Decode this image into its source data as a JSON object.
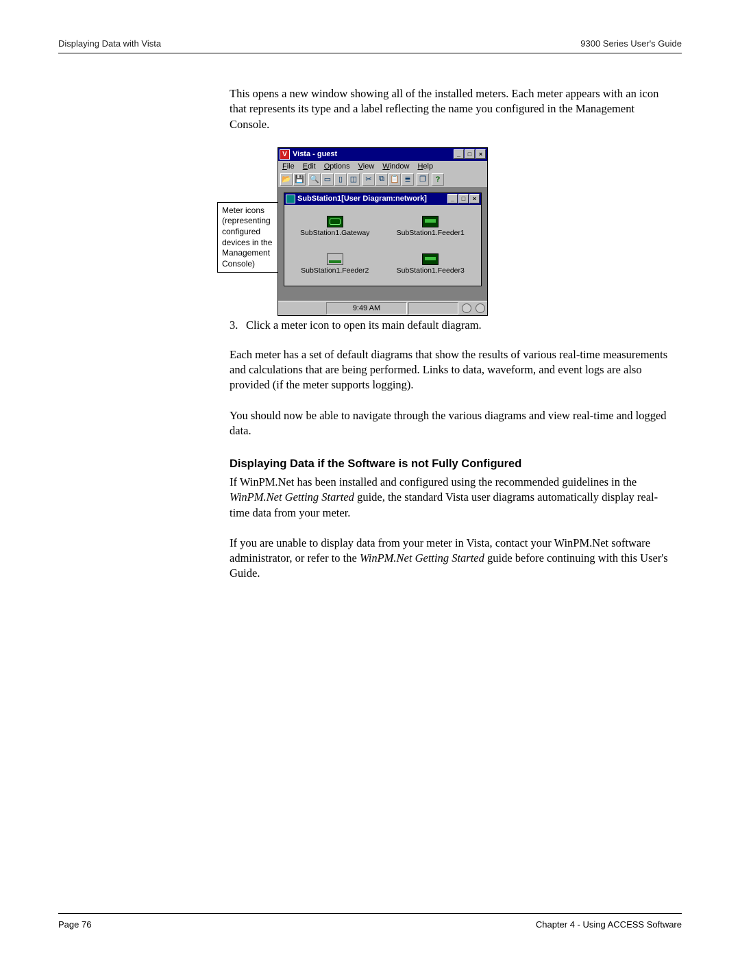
{
  "header": {
    "left": "Displaying Data with Vista",
    "right": "9300 Series User's Guide"
  },
  "intro_para": "This opens a new window showing all of the installed meters. Each meter appears with an icon that represents its type and a label reflecting the name you configured in the Management Console.",
  "callout": "Meter icons (representing configured devices in the Management Console)",
  "vista": {
    "title": "Vista - guest",
    "menus": {
      "file": "File",
      "edit": "Edit",
      "options": "Options",
      "view": "View",
      "window": "Window",
      "help": "Help"
    },
    "child_title": "SubStation1[User Diagram:network]",
    "meters": {
      "m1": "SubStation1.Gateway",
      "m2": "SubStation1.Feeder1",
      "m3": "SubStation1.Feeder2",
      "m4": "SubStation1.Feeder3"
    },
    "status_time": "9:49 AM"
  },
  "step3": {
    "num": "3.",
    "text": "Click a meter icon to open its main default diagram."
  },
  "para_diagrams": "Each meter has a set of default diagrams that show the results of various real-time measurements and calculations that are being performed. Links to data, waveform, and event logs are also provided (if the meter supports logging).",
  "para_navigate": "You should now be able to navigate through the various diagrams and view real-time and logged data.",
  "section_title": "Displaying Data if the Software is not Fully Configured",
  "sec_p1_a": "If WinPM.Net has been installed and configured using the recommended guidelines in the ",
  "sec_p1_i": "WinPM.Net Getting Started",
  "sec_p1_b": " guide, the standard Vista user diagrams automatically display real-time data from your meter.",
  "sec_p2_a": "If you are unable to display data from your meter in Vista, contact your WinPM.Net software administrator, or refer to the ",
  "sec_p2_i": "WinPM.Net Getting Started",
  "sec_p2_b": " guide before continuing with this User's Guide.",
  "footer": {
    "left": "Page 76",
    "right": "Chapter 4 - Using ACCESS Software"
  }
}
